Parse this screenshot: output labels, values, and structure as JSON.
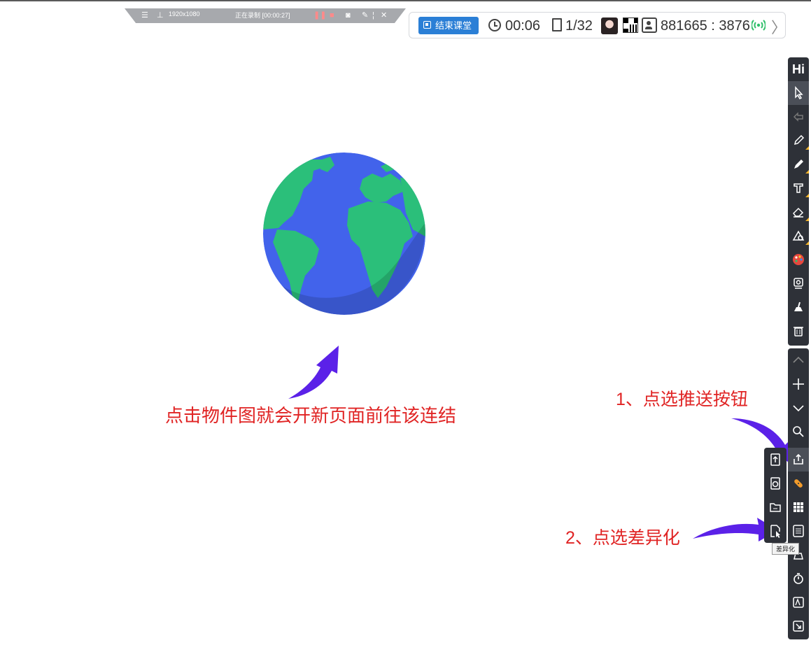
{
  "recording_bar": {
    "resolution": "1920x1080",
    "status": "正在录制 [00:00:27]"
  },
  "status_bar": {
    "end_class_label": "结束课堂",
    "timer": "00:06",
    "pages": "1/32",
    "room": "881665 : 3876"
  },
  "toolbar": {
    "hi_label": "Hi",
    "tooltip": "差异化"
  },
  "annotations": {
    "main": "点击物件图就会开新页面前往该连结",
    "step1": "1、点选推送按钮",
    "step2": "2、点选差异化"
  },
  "colors": {
    "annotation": "#e02424",
    "arrow": "#5b21e8",
    "toolbar_bg": "#2e3138",
    "ocean": "#4263eb",
    "land": "#2bbf7a",
    "accent": "#2b7fd6"
  }
}
